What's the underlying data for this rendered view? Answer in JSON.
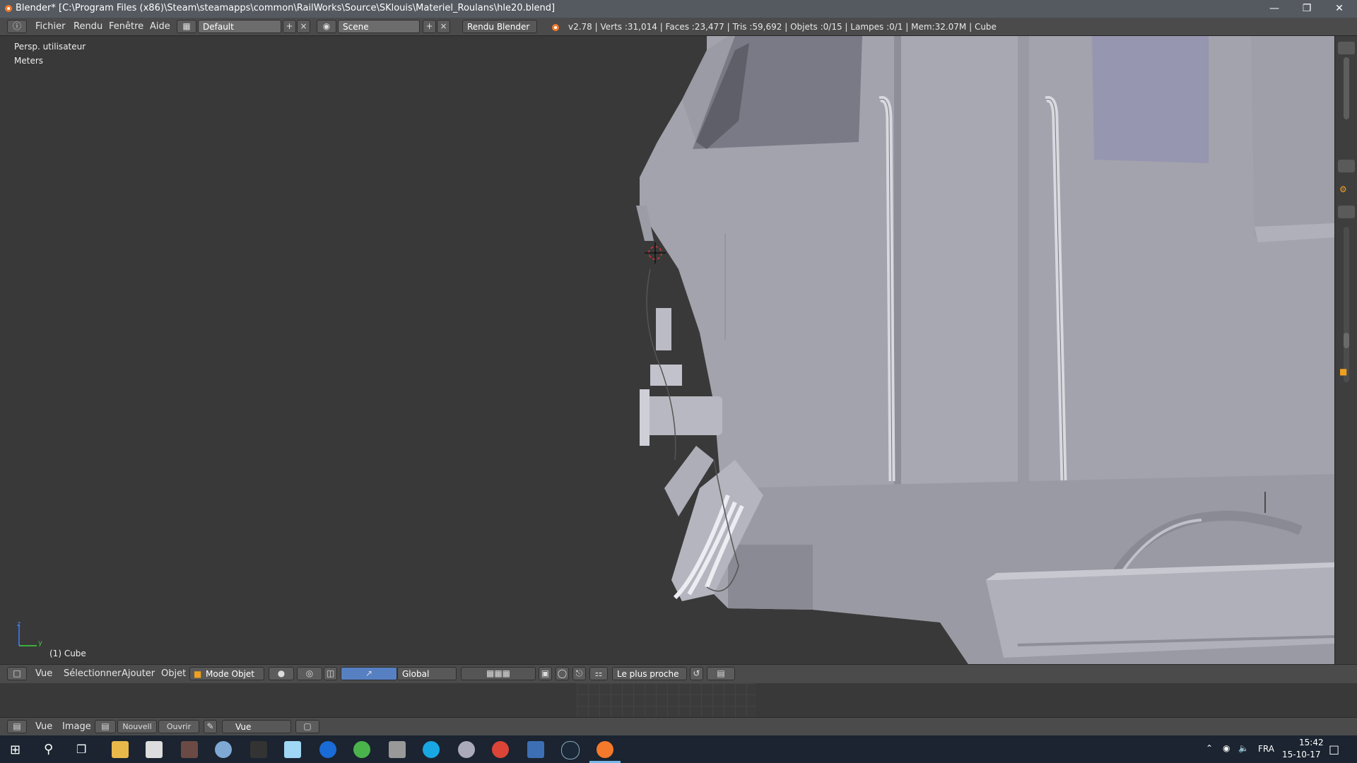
{
  "window": {
    "title": "Blender* [C:\\Program Files (x86)\\Steam\\steamapps\\common\\RailWorks\\Source\\SKlouis\\Materiel_Roulans\\hle20.blend]"
  },
  "infobar": {
    "menus": [
      "Fichier",
      "Rendu",
      "Fenêtre",
      "Aide"
    ],
    "layout": "Default",
    "scene": "Scene",
    "render_engine": "Rendu Blender",
    "stats": "v2.78 | Verts :31,014 | Faces :23,477 | Tris :59,692 | Objets :0/15 | Lampes :0/1 | Mem:32.07M | Cube"
  },
  "viewport": {
    "view_label": "Persp. utilisateur",
    "units_label": "Meters",
    "object_label": "(1) Cube",
    "axis_z": "z",
    "axis_y": "y"
  },
  "view_header": {
    "menus": [
      "Vue",
      "Sélectionner",
      "Ajouter",
      "Objet"
    ],
    "mode": "Mode Objet",
    "orientation": "Global",
    "snap": "Le plus proche"
  },
  "image_header": {
    "menus": [
      "Vue",
      "Image"
    ],
    "new_label": "Nouvell",
    "open_label": "Ouvrir",
    "view_select": "Vue"
  },
  "taskbar": {
    "lang": "FRA",
    "time": "15:42",
    "date": "15-10-17"
  },
  "colors": {
    "viewport_bg": "#393939",
    "model": "#a3a3ad",
    "accent_blue": "#5680c2",
    "taskbar": "#1b2430"
  }
}
